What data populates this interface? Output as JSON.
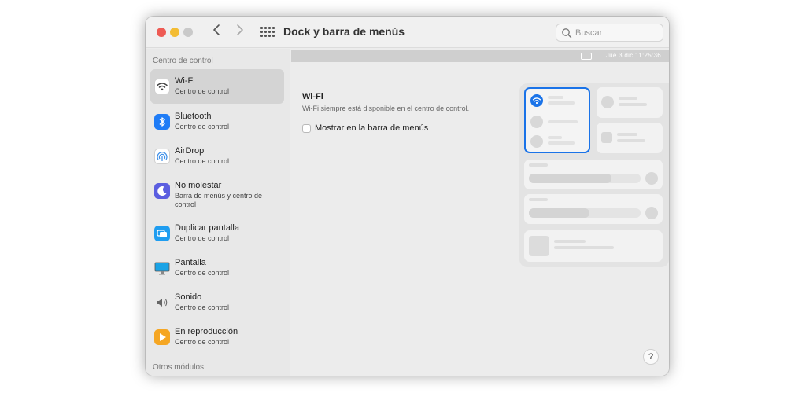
{
  "window": {
    "title": "Dock y barra de menús"
  },
  "search": {
    "placeholder": "Buscar"
  },
  "sidebar": {
    "section_control": "Centro de control",
    "section_other": "Otros módulos",
    "items": [
      {
        "title": "Wi-Fi",
        "subtitle": "Centro de control",
        "icon": "wifi-icon",
        "color": "#ffffff"
      },
      {
        "title": "Bluetooth",
        "subtitle": "Centro de control",
        "icon": "bluetooth-icon",
        "color": "#1f7cf6"
      },
      {
        "title": "AirDrop",
        "subtitle": "Centro de control",
        "icon": "airdrop-icon",
        "color": "#ffffff"
      },
      {
        "title": "No molestar",
        "subtitle": "Barra de menús y centro de control",
        "icon": "moon-icon",
        "color": "#5b5ee0"
      },
      {
        "title": "Duplicar pantalla",
        "subtitle": "Centro de control",
        "icon": "screen-mirroring-icon",
        "color": "#1f9df0"
      },
      {
        "title": "Pantalla",
        "subtitle": "Centro de control",
        "icon": "display-icon",
        "color": "#1aa3e6"
      },
      {
        "title": "Sonido",
        "subtitle": "Centro de control",
        "icon": "speaker-icon",
        "color": "#ffffff"
      },
      {
        "title": "En reproducción",
        "subtitle": "Centro de control",
        "icon": "play-icon",
        "color": "#f5a623"
      }
    ]
  },
  "main": {
    "menubar_time": "Jue 3 dic  11:25:36",
    "title": "Wi-Fi",
    "description": "Wi-Fi siempre está disponible en el centro de control.",
    "checkbox_label": "Mostrar en la barra de menús",
    "checkbox_checked": false,
    "accent": "#1a73e8"
  },
  "help": {
    "label": "?"
  }
}
